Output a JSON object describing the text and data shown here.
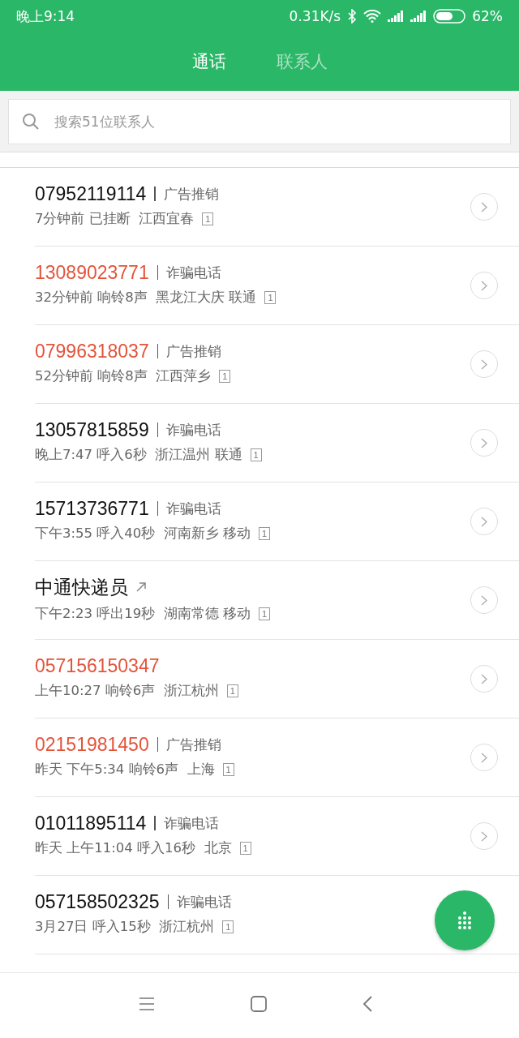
{
  "status_bar": {
    "time": "晚上9:14",
    "speed": "0.31K/s",
    "battery": "62%"
  },
  "tabs": [
    {
      "label": "通话",
      "selected": true
    },
    {
      "label": "联系人",
      "selected": false
    }
  ],
  "search": {
    "placeholder": "搜索51位联系人"
  },
  "calls": [
    {
      "number": "07952119114",
      "missed": false,
      "outgoing": false,
      "tag": "广告推销",
      "detail": "7分钟前 已挂断  江西宜春",
      "sim": "1"
    },
    {
      "number": "13089023771",
      "missed": true,
      "outgoing": false,
      "tag": "诈骗电话",
      "detail": "32分钟前 响铃8声  黑龙江大庆 联通",
      "sim": "1"
    },
    {
      "number": "07996318037",
      "missed": true,
      "outgoing": false,
      "tag": "广告推销",
      "detail": "52分钟前 响铃8声  江西萍乡",
      "sim": "1"
    },
    {
      "number": "13057815859",
      "missed": false,
      "outgoing": false,
      "tag": "诈骗电话",
      "detail": "晚上7:47 呼入6秒  浙江温州 联通",
      "sim": "1"
    },
    {
      "number": "15713736771",
      "missed": false,
      "outgoing": false,
      "tag": "诈骗电话",
      "detail": "下午3:55 呼入40秒  河南新乡 移动",
      "sim": "1"
    },
    {
      "number": "中通快递员",
      "missed": false,
      "outgoing": true,
      "detail": "下午2:23 呼出19秒  湖南常德 移动",
      "sim": "1"
    },
    {
      "number": "057156150347",
      "missed": true,
      "outgoing": false,
      "detail": "上午10:27 响铃6声  浙江杭州",
      "sim": "1"
    },
    {
      "number": "02151981450",
      "missed": true,
      "outgoing": false,
      "tag": "广告推销",
      "detail": "昨天 下午5:34 响铃6声  上海",
      "sim": "1"
    },
    {
      "number": "01011895114",
      "missed": false,
      "outgoing": false,
      "tag": "诈骗电话",
      "detail": "昨天 上午11:04 呼入16秒  北京",
      "sim": "1"
    },
    {
      "number": "057158502325",
      "missed": false,
      "outgoing": false,
      "tag": "诈骗电话",
      "detail": "3月27日 呼入15秒  浙江杭州",
      "sim": "1"
    }
  ]
}
